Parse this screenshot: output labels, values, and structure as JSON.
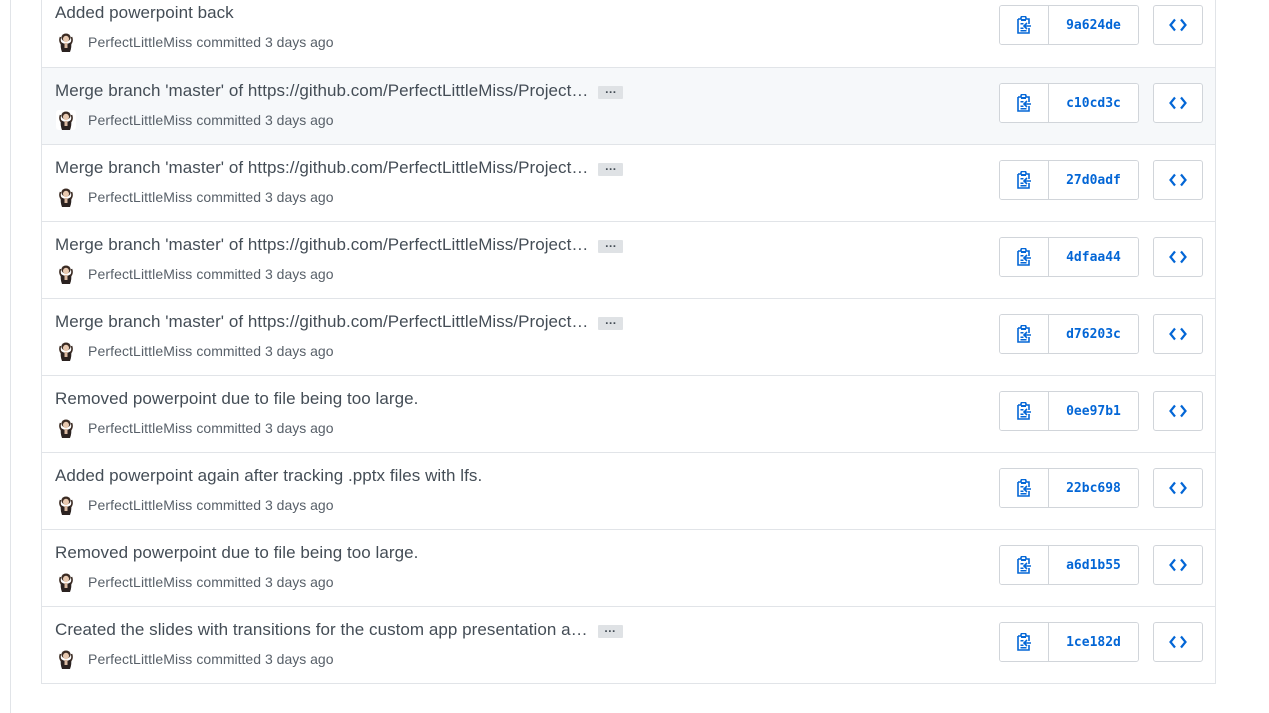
{
  "commits": [
    {
      "title": "Added powerpoint back",
      "has_more": false,
      "author": "PerfectLittleMiss",
      "action": "committed",
      "time": "3 days ago",
      "sha": "9a624de",
      "more_label": "…"
    },
    {
      "title": "Merge branch 'master' of https://github.com/PerfectLittleMiss/Project…",
      "has_more": true,
      "author": "PerfectLittleMiss",
      "action": "committed",
      "time": "3 days ago",
      "sha": "c10cd3c",
      "more_label": "…"
    },
    {
      "title": "Merge branch 'master' of https://github.com/PerfectLittleMiss/Project…",
      "has_more": true,
      "author": "PerfectLittleMiss",
      "action": "committed",
      "time": "3 days ago",
      "sha": "27d0adf",
      "more_label": "…"
    },
    {
      "title": "Merge branch 'master' of https://github.com/PerfectLittleMiss/Project…",
      "has_more": true,
      "author": "PerfectLittleMiss",
      "action": "committed",
      "time": "3 days ago",
      "sha": "4dfaa44",
      "more_label": "…"
    },
    {
      "title": "Merge branch 'master' of https://github.com/PerfectLittleMiss/Project…",
      "has_more": true,
      "author": "PerfectLittleMiss",
      "action": "committed",
      "time": "3 days ago",
      "sha": "d76203c",
      "more_label": "…"
    },
    {
      "title": "Removed powerpoint due to file being too large.",
      "has_more": false,
      "author": "PerfectLittleMiss",
      "action": "committed",
      "time": "3 days ago",
      "sha": "0ee97b1",
      "more_label": "…"
    },
    {
      "title": "Added powerpoint again after tracking .pptx files with lfs.",
      "has_more": false,
      "author": "PerfectLittleMiss",
      "action": "committed",
      "time": "3 days ago",
      "sha": "22bc698",
      "more_label": "…"
    },
    {
      "title": "Removed powerpoint due to file being too large.",
      "has_more": false,
      "author": "PerfectLittleMiss",
      "action": "committed",
      "time": "3 days ago",
      "sha": "a6d1b55",
      "more_label": "…"
    },
    {
      "title": "Created the slides with transitions for the custom app presentation a…",
      "has_more": true,
      "author": "PerfectLittleMiss",
      "action": "committed",
      "time": "3 days ago",
      "sha": "1ce182d",
      "more_label": "…"
    }
  ],
  "hovered_row": 1,
  "icons": {
    "copy": "clippy-icon",
    "browse": "code-icon",
    "avatar": "avatar-icon"
  },
  "colors": {
    "link": "#0366d6",
    "hover_bg": "#f6f8fa",
    "border": "#e1e4e8"
  }
}
